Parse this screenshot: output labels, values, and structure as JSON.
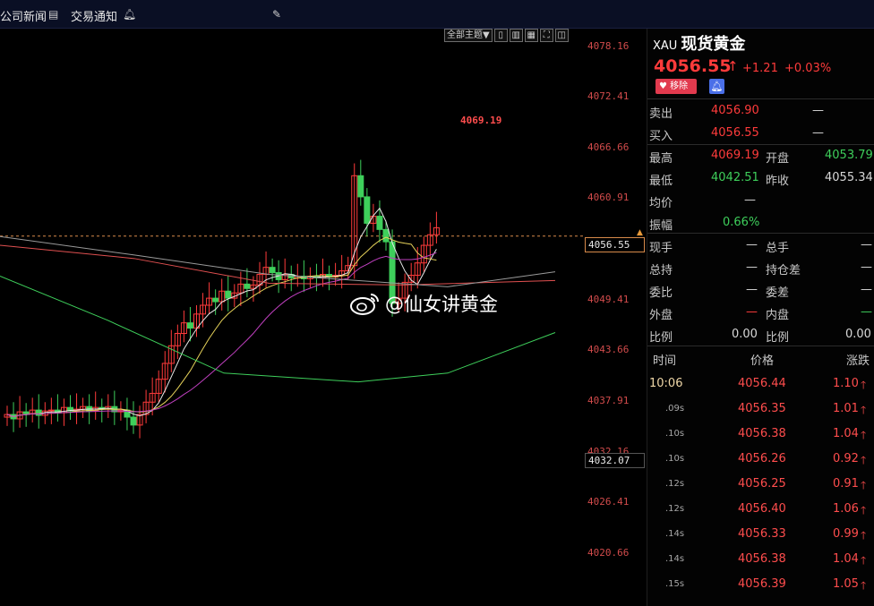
{
  "topbar": {
    "news_label": "公司新闻",
    "notice_label": "交易通知"
  },
  "toolbar": {
    "theme_label": "全部主题▼"
  },
  "axis": {
    "ticks": [
      "4078.16",
      "4072.41",
      "4066.66",
      "4060.91",
      "4049.41",
      "4043.66",
      "4037.91",
      "4032.16",
      "4026.41",
      "4020.66"
    ],
    "current_price_label": "4056.55",
    "low_label": "4032.07",
    "high_annotation": "4069.19"
  },
  "watermark": {
    "text": "@仙女讲黄金"
  },
  "quote": {
    "symbol": "XAU",
    "name": "现货黄金",
    "price": "4056.55",
    "change": "+1.21",
    "change_pct": "+0.03%",
    "remove_label": "移除",
    "sell_label": "卖出",
    "sell_value": "4056.90",
    "sell_vol": "—",
    "buy_label": "买入",
    "buy_value": "4056.55",
    "buy_vol": "—",
    "high_label": "最高",
    "high_value": "4069.19",
    "open_label": "开盘",
    "open_value": "4053.79",
    "low_label": "最低",
    "low_value": "4042.51",
    "prev_label": "昨收",
    "prev_value": "4055.34",
    "avg_label": "均价",
    "avg_value": "—",
    "amp_label": "振幅",
    "amp_value": "0.66%",
    "cur_vol_label": "现手",
    "cur_vol_value": "—",
    "total_vol_label": "总手",
    "total_vol_value": "—",
    "total_hold_label": "总持",
    "total_hold_value": "—",
    "hold_diff_label": "持仓差",
    "hold_diff_value": "—",
    "ratio_label": "委比",
    "ratio_value": "—",
    "diff_label": "委差",
    "diff_value": "—",
    "outer_label": "外盘",
    "outer_value": "—",
    "inner_label": "内盘",
    "inner_value": "—",
    "pct_label": "比例",
    "pct_value": "0.00",
    "pct2_label": "比例",
    "pct2_value": "0.00"
  },
  "ticks_table": {
    "headers": [
      "时间",
      "价格",
      "涨跌"
    ],
    "rows": [
      {
        "time": "10:06",
        "price": "4056.44",
        "chg": "1.10"
      },
      {
        "time": ".09s",
        "price": "4056.35",
        "chg": "1.01"
      },
      {
        "time": ".10s",
        "price": "4056.38",
        "chg": "1.04"
      },
      {
        "time": ".10s",
        "price": "4056.26",
        "chg": "0.92"
      },
      {
        "time": ".12s",
        "price": "4056.25",
        "chg": "0.91"
      },
      {
        "time": ".12s",
        "price": "4056.40",
        "chg": "1.06"
      },
      {
        "time": ".14s",
        "price": "4056.33",
        "chg": "0.99"
      },
      {
        "time": ".14s",
        "price": "4056.38",
        "chg": "1.04"
      },
      {
        "time": ".15s",
        "price": "4056.39",
        "chg": "1.05"
      }
    ]
  },
  "colors": {
    "up": "#ff3b3b",
    "down": "#3ecf5b",
    "accent": "#e89a3a"
  }
}
